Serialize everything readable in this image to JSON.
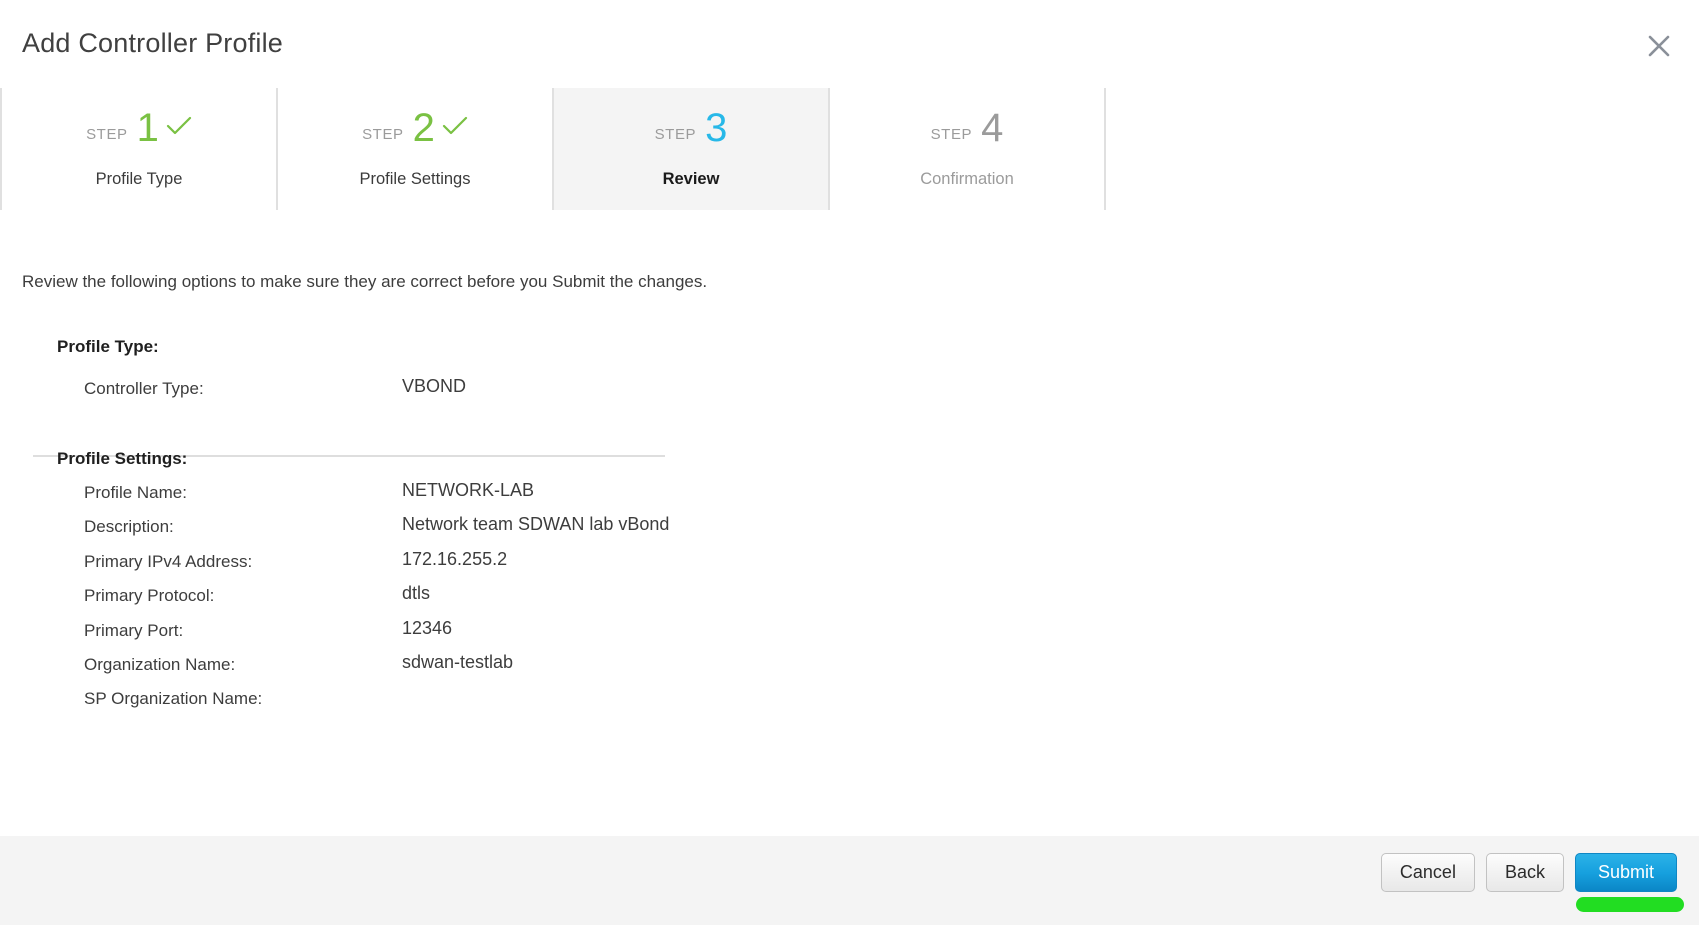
{
  "header": {
    "title": "Add Controller Profile",
    "close_icon": "close-icon"
  },
  "stepper": {
    "step_word": "STEP",
    "steps": [
      {
        "number": "1",
        "label": "Profile Type",
        "state": "done"
      },
      {
        "number": "2",
        "label": "Profile Settings",
        "state": "done"
      },
      {
        "number": "3",
        "label": "Review",
        "state": "current"
      },
      {
        "number": "4",
        "label": "Confirmation",
        "state": "todo"
      }
    ]
  },
  "main": {
    "intro": "Review the following options to make sure they are correct before you Submit the changes.",
    "sections": [
      {
        "heading": "Profile Type:",
        "rows": [
          {
            "label": "Controller Type:",
            "value": "VBOND"
          }
        ]
      },
      {
        "heading": "Profile Settings:",
        "rows": [
          {
            "label": "Profile Name:",
            "value": "NETWORK-LAB"
          },
          {
            "label": "Description:",
            "value": "Network team SDWAN lab vBond"
          },
          {
            "label": "Primary IPv4 Address:",
            "value": "172.16.255.2"
          },
          {
            "label": "Primary Protocol:",
            "value": "dtls"
          },
          {
            "label": "Primary Port:",
            "value": "12346"
          },
          {
            "label": "Organization Name:",
            "value": "sdwan-testlab"
          },
          {
            "label": "SP Organization Name:",
            "value": ""
          }
        ]
      }
    ]
  },
  "footer": {
    "cancel_label": "Cancel",
    "back_label": "Back",
    "submit_label": "Submit"
  },
  "colors": {
    "done": "#7ac143",
    "current": "#27b8e8",
    "todo": "#9b9b9b",
    "primary_button": "#16a0de",
    "cursor_highlight": "#22dd22",
    "footer_bg": "#f4f4f4"
  }
}
